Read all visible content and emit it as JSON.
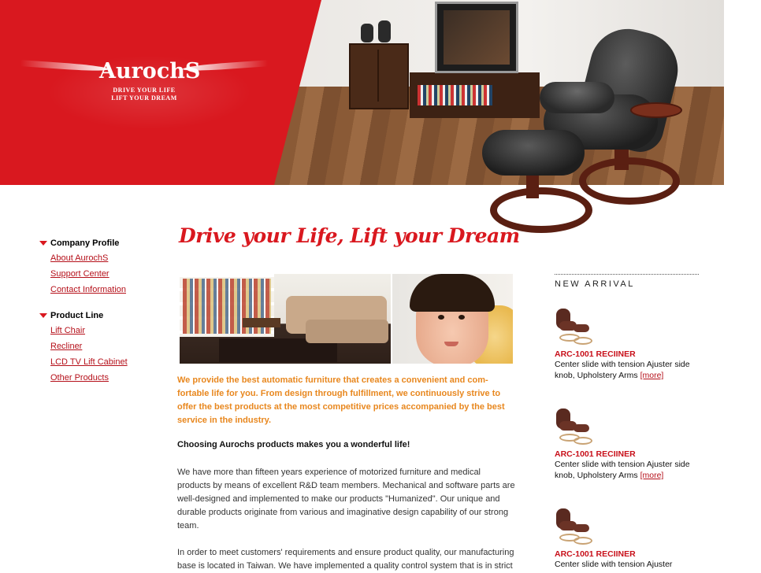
{
  "brand": {
    "logo": "AurochS",
    "tagline_1": "DRIVE YOUR LIFE",
    "tagline_2": "LIFT YOUR DREAM"
  },
  "colors": {
    "brand_red": "#d9181f",
    "link_red": "#b5101a",
    "intro_orange": "#e8871e"
  },
  "sidebar": {
    "groups": [
      {
        "title": "Company Profile",
        "items": [
          "About AurochS",
          "Support Center",
          "Contact Information"
        ]
      },
      {
        "title": "Product Line",
        "items": [
          "Lift Chair",
          "Recliner",
          "LCD TV Lift Cabinet",
          "Other Products"
        ]
      }
    ]
  },
  "main": {
    "headline": "Drive your Life, Lift your Dream",
    "intro": "We provide the best automatic furniture that creates a convenient and com-fortable life for you. From design through fulfillment, we continuously strive to offer the best products at the most competitive prices accompanied by the best service in the industry.",
    "subhead": "Choosing Aurochs products makes you a wonderful life!",
    "paragraph_1": "We have more than fifteen years experience of motorized furniture and medical products by means of excellent R&D team members. Mechanical and software parts are well-designed and implemented to make our products \"Humanized\". Our unique and durable products originate from various and imaginative design capability of our strong team.",
    "paragraph_2": "In order to meet customers' requirements and ensure product quality, our manufacturing base is located in Taiwan. We have implemented a quality control system that is in strict"
  },
  "new_arrival": {
    "heading": "NEW ARRIVAL",
    "products": [
      {
        "title": "ARC-1001 RECIINER",
        "desc": "Center slide with tension Ajuster side knob, Upholstery Arms",
        "more": "[more]"
      },
      {
        "title": "ARC-1001 RECIINER",
        "desc": "Center slide with tension Ajuster side knob, Upholstery Arms",
        "more": "[more]"
      },
      {
        "title": "ARC-1001 RECIINER",
        "desc": "Center slide with tension Ajuster",
        "more": ""
      }
    ]
  }
}
